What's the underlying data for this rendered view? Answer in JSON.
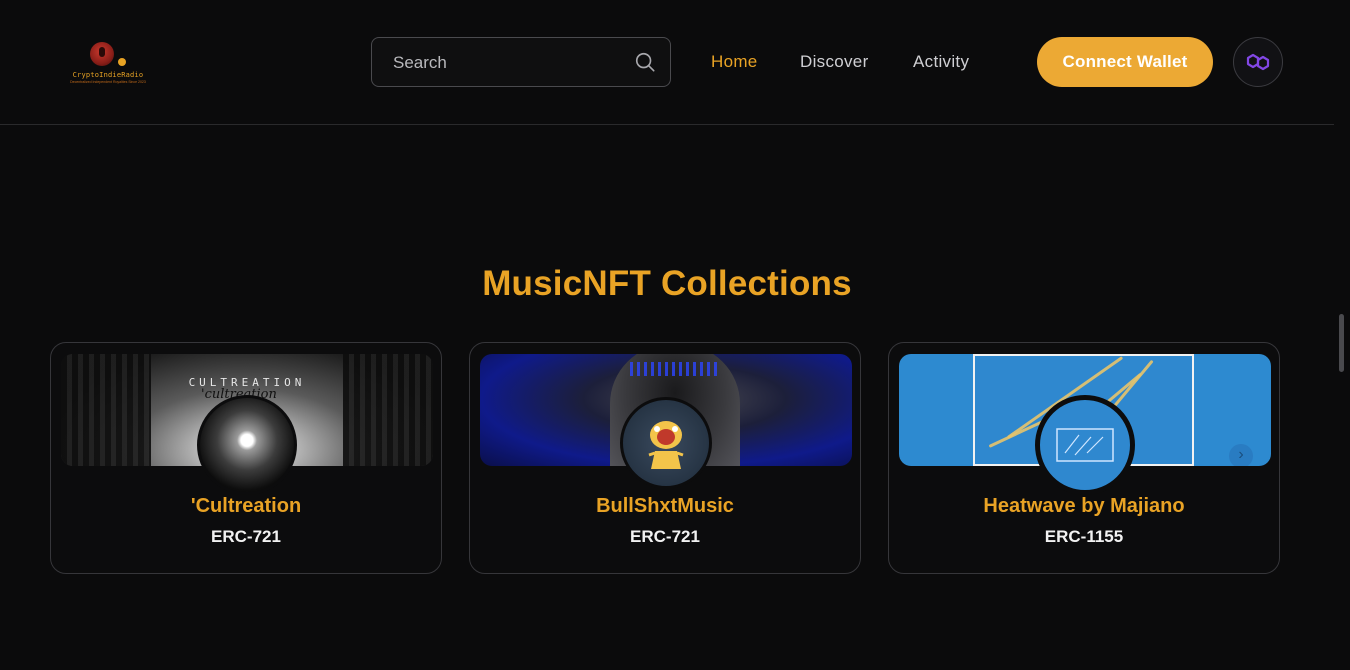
{
  "header": {
    "logo": {
      "name": "CryptoIndieRadio",
      "tagline": "Decentralized Independent Royalties Since 2023"
    },
    "search": {
      "placeholder": "Search"
    },
    "nav": [
      {
        "label": "Home",
        "active": true
      },
      {
        "label": "Discover",
        "active": false
      },
      {
        "label": "Activity",
        "active": false
      }
    ],
    "connect_wallet_label": "Connect Wallet",
    "network_icon": "polygon-icon"
  },
  "main": {
    "title": "MusicNFT Collections",
    "collections": [
      {
        "name": "'Cultreation",
        "standard": "ERC-721",
        "banner_text": "CULTREATION",
        "banner_subtext": "'cultreation"
      },
      {
        "name": "BullShxtMusic",
        "standard": "ERC-721"
      },
      {
        "name": "Heatwave by Majiano",
        "standard": "ERC-1155"
      }
    ]
  },
  "colors": {
    "accent": "#e9a325",
    "button": "#eca934",
    "background": "#0b0b0c",
    "card_border": "#36363a",
    "polygon": "#8247e5"
  }
}
